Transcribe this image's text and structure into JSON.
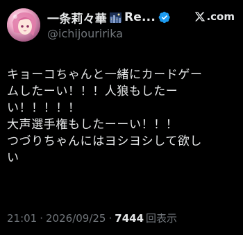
{
  "author": {
    "display_name": "一条莉々華",
    "name_suffix": "Re...",
    "handle": "@ichijouririka",
    "emoji_icon": "night-city-emoji-icon",
    "verified_icon": "verified-badge-icon"
  },
  "brand": {
    "logo_icon": "x-logo-icon",
    "text": ".com"
  },
  "post": {
    "lines": [
      "キョーコちゃんと一緒にカードゲー",
      "ムしたーい！！！人狼もしたー",
      "い！！！！！",
      "大声選手権もしたーーい！！！",
      "つづりちゃんにはヨシヨシして欲し",
      "い"
    ]
  },
  "footer": {
    "time": "21:01",
    "date": "2026/09/25",
    "separator": "·",
    "views_count": "7444",
    "views_label": "回表示"
  },
  "colors": {
    "background": "#000000",
    "primary_text": "#e7e9ea",
    "secondary_text": "#71767b",
    "verified_blue": "#1d9bf0"
  }
}
